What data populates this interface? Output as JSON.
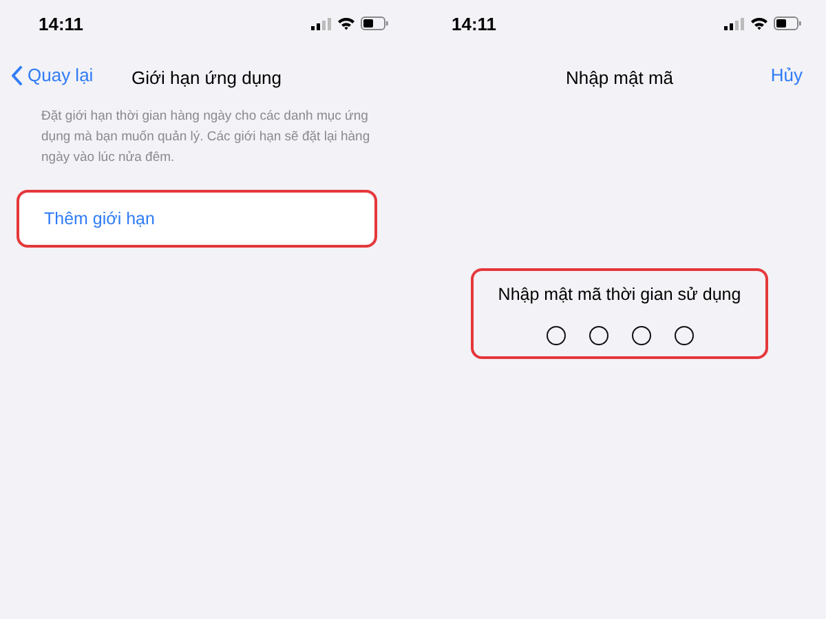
{
  "screens": [
    {
      "status_bar": {
        "time": "14:11"
      },
      "nav": {
        "back": "Quay lại",
        "title": "Giới hạn ứng dụng"
      },
      "description": "Đặt giới hạn thời gian hàng ngày cho các danh mục ứng dụng mà bạn muốn quản lý. Các giới hạn sẽ đặt lại hàng ngày vào lúc nửa đêm.",
      "action": {
        "label": "Thêm giới hạn",
        "highlighted": true
      }
    },
    {
      "status_bar": {
        "time": "14:11"
      },
      "nav": {
        "title": "Nhập mật mã",
        "cancel": "Hủy"
      },
      "passcode": {
        "prompt": "Nhập mật mã thời gian sử dụng",
        "highlighted": true,
        "digits": [
          {
            "filled": false
          },
          {
            "filled": false
          },
          {
            "filled": false
          },
          {
            "filled": false
          }
        ]
      }
    }
  ]
}
